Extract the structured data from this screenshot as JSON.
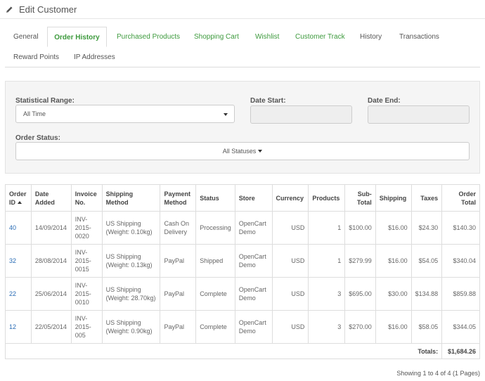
{
  "header": {
    "title": "Edit Customer",
    "icon": "pencil-icon"
  },
  "tabs": {
    "row1": [
      "General",
      "Order History",
      "Purchased Products",
      "Shopping Cart",
      "Wishlist",
      "Customer Track",
      "History",
      "Transactions"
    ],
    "row2": [
      "Reward Points",
      "IP Addresses"
    ],
    "active": "Order History",
    "accent_color": "#3d9a3d"
  },
  "filter": {
    "range_label": "Statistical Range:",
    "range_value": "All Time",
    "date_start_label": "Date Start:",
    "date_start_value": "",
    "date_end_label": "Date End:",
    "date_end_value": "",
    "status_label": "Order Status:",
    "status_value": "All Statuses"
  },
  "table": {
    "headers": [
      "Order ID",
      "Date Added",
      "Invoice No.",
      "Shipping Method",
      "Payment Method",
      "Status",
      "Store",
      "Currency",
      "Products",
      "Sub-Total",
      "Shipping",
      "Taxes",
      "Order Total"
    ],
    "rows": [
      {
        "order_id": "40",
        "date": "14/09/2014",
        "invoice": "INV-2015-0020",
        "shipping_method": "US Shipping (Weight: 0.10kg)",
        "payment": "Cash On Delivery",
        "status": "Processing",
        "store": "OpenCart Demo",
        "currency": "USD",
        "products": "1",
        "subtotal": "$100.00",
        "shipping": "$16.00",
        "taxes": "$24.30",
        "total": "$140.30"
      },
      {
        "order_id": "32",
        "date": "28/08/2014",
        "invoice": "INV-2015-0015",
        "shipping_method": "US Shipping (Weight: 0.13kg)",
        "payment": "PayPal",
        "status": "Shipped",
        "store": "OpenCart Demo",
        "currency": "USD",
        "products": "1",
        "subtotal": "$279.99",
        "shipping": "$16.00",
        "taxes": "$54.05",
        "total": "$340.04"
      },
      {
        "order_id": "22",
        "date": "25/06/2014",
        "invoice": "INV-2015-0010",
        "shipping_method": "US Shipping (Weight: 28.70kg)",
        "payment": "PayPal",
        "status": "Complete",
        "store": "OpenCart Demo",
        "currency": "USD",
        "products": "3",
        "subtotal": "$695.00",
        "shipping": "$30.00",
        "taxes": "$134.88",
        "total": "$859.88"
      },
      {
        "order_id": "12",
        "date": "22/05/2014",
        "invoice": "INV-2015-005",
        "shipping_method": "US Shipping (Weight: 0.90kg)",
        "payment": "PayPal",
        "status": "Complete",
        "store": "OpenCart Demo",
        "currency": "USD",
        "products": "3",
        "subtotal": "$270.00",
        "shipping": "$16.00",
        "taxes": "$58.05",
        "total": "$344.05"
      }
    ],
    "totals_label": "Totals:",
    "totals_value": "$1,684.26"
  },
  "pager": {
    "text": "Showing 1 to 4 of 4 (1 Pages)"
  }
}
